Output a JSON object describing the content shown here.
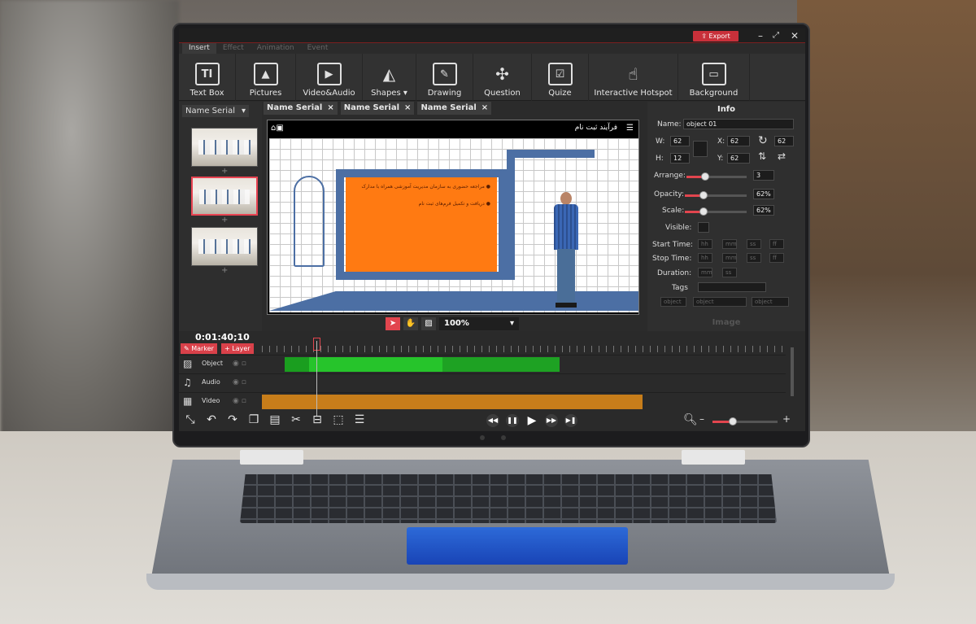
{
  "app": {
    "export_label": "Export",
    "tabs": [
      {
        "label": "Insert"
      },
      {
        "label": "Effect"
      },
      {
        "label": "Animation"
      },
      {
        "label": "Event"
      }
    ]
  },
  "ribbon": [
    {
      "label": "Text Box",
      "icon": "text-box-icon"
    },
    {
      "label": "Pictures",
      "icon": "pictures-icon"
    },
    {
      "label": "Video&Audio",
      "icon": "video-audio-icon"
    },
    {
      "label": "Shapes ▾",
      "icon": "shapes-icon"
    },
    {
      "label": "Drawing",
      "icon": "drawing-icon"
    },
    {
      "label": "Question",
      "icon": "question-icon"
    },
    {
      "label": "Quize",
      "icon": "quiz-icon"
    },
    {
      "label": "Interactive Hotspot",
      "icon": "hotspot-icon"
    },
    {
      "label": "Background",
      "icon": "background-icon"
    }
  ],
  "slides_panel": {
    "dropdown": "Name Serial"
  },
  "doc_tabs": [
    {
      "label": "Name Serial"
    },
    {
      "label": "Name Serial"
    },
    {
      "label": "Name Serial"
    }
  ],
  "canvas": {
    "title": "فرآیند ثبت نام",
    "bullets": [
      "● مراجعه حضوری به سازمان مدیریت آموزشی همراه با مدارک",
      "● دریافت و تکمیل فرم‌های ثبت نام"
    ],
    "zoom": "100%"
  },
  "info": {
    "title": "Info",
    "name_label": "Name:",
    "name_value": "object 01",
    "w_label": "W:",
    "w_value": "62",
    "h_label": "H:",
    "h_value": "12",
    "x_label": "X:",
    "x_value": "62",
    "y_label": "Y:",
    "y_value": "62",
    "rot_value": "62",
    "arrange_label": "Arrange:",
    "arrange_value": "3",
    "opacity_label": "Opacity:",
    "opacity_value": "62%",
    "scale_label": "Scale:",
    "scale_value": "62%",
    "visible_label": "Visible:",
    "start_label": "Start Time:",
    "stop_label": "Stop Time:",
    "duration_label": "Duration:",
    "tags_label": "Tags",
    "hh": "hh",
    "mm": "mm",
    "ss": "ss",
    "ff": "ff",
    "object_placeholder": "object",
    "footer": "Image"
  },
  "timeline": {
    "timecode": "0:01:40;10",
    "marker_label": "Marker",
    "layer_label": "Layer",
    "tracks": [
      {
        "label": "Object"
      },
      {
        "label": "Audio"
      },
      {
        "label": "Video"
      }
    ]
  }
}
